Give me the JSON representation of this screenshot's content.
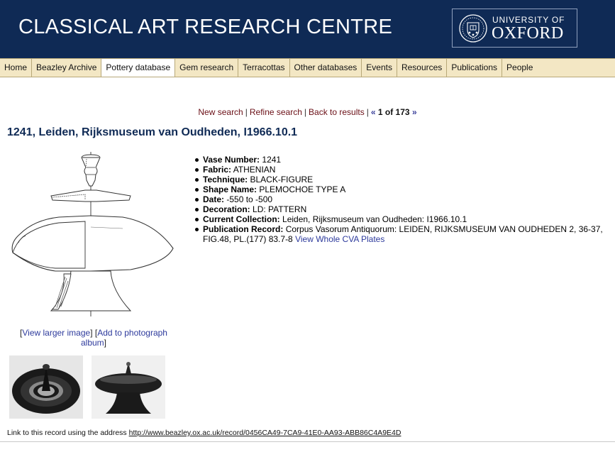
{
  "header": {
    "site_title": "CLASSICAL ART RESEARCH CENTRE",
    "university_line1": "UNIVERSITY OF",
    "university_line2": "OXFORD",
    "brand_color": "#0f2a55"
  },
  "nav": {
    "items": [
      {
        "label": "Home"
      },
      {
        "label": "Beazley Archive"
      },
      {
        "label": "Pottery database",
        "active": true
      },
      {
        "label": "Gem research"
      },
      {
        "label": "Terracottas"
      },
      {
        "label": "Other databases"
      },
      {
        "label": "Events"
      },
      {
        "label": "Resources"
      },
      {
        "label": "Publications"
      },
      {
        "label": "People"
      }
    ],
    "bg_color": "#f3e7c4"
  },
  "result_nav": {
    "new_search": "New search",
    "refine_search": "Refine search",
    "back_to_results": "Back to results",
    "prev_arrow": "«",
    "counter": "1 of 173",
    "next_arrow": "»"
  },
  "record": {
    "title": "1241, Leiden, Rijksmuseum van Oudheden, I1966.10.1",
    "fields": [
      {
        "label": "Vase Number:",
        "value": "1241"
      },
      {
        "label": "Fabric:",
        "value": "ATHENIAN"
      },
      {
        "label": "Technique:",
        "value": "BLACK-FIGURE"
      },
      {
        "label": "Shape Name:",
        "value": "PLEMOCHOE TYPE A"
      },
      {
        "label": "Date:",
        "value": "-550 to -500"
      },
      {
        "label": "Decoration:",
        "value": "LD: PATTERN"
      },
      {
        "label": "Current Collection:",
        "value": "Leiden, Rijksmuseum van Oudheden: I1966.10.1"
      },
      {
        "label": "Publication Record:",
        "value": "Corpus Vasorum Antiquorum: LEIDEN, RIJKSMUSEUM VAN OUDHEDEN 2, 36-37, FIG.48, PL.(177) 83.7-8",
        "link": "View Whole CVA Plates"
      }
    ]
  },
  "image_links": {
    "view_larger": "View larger image",
    "add_to_album": "Add to photograph album"
  },
  "footer": {
    "link_text": "Link to this record using the address",
    "url": "http://www.beazley.ox.ac.uk/record/0456CA49-7CA9-41E0-AA93-ABB86C4A9E4D"
  }
}
